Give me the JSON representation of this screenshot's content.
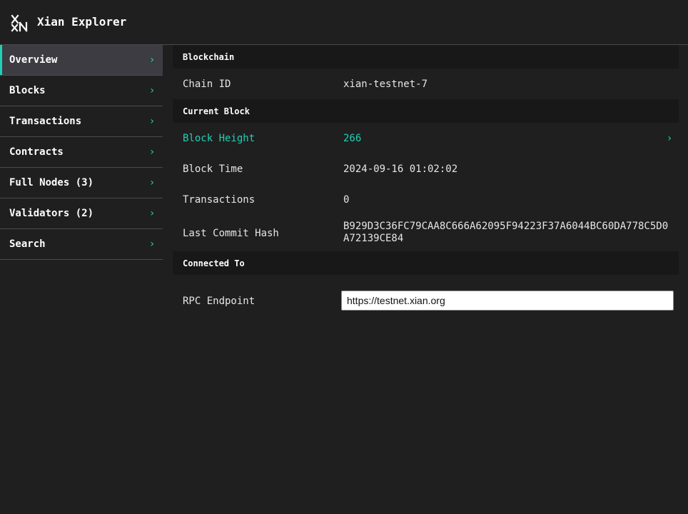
{
  "app": {
    "title": "Xian Explorer",
    "logo_icon": "xian-logo-icon",
    "accent_color": "#1fd1b5"
  },
  "sidebar": {
    "items": [
      {
        "label": "Overview",
        "active": true
      },
      {
        "label": "Blocks"
      },
      {
        "label": "Transactions"
      },
      {
        "label": "Contracts"
      },
      {
        "label": "Full Nodes (3)"
      },
      {
        "label": "Validators (2)"
      },
      {
        "label": "Search"
      }
    ],
    "chevron": "›"
  },
  "main": {
    "blockchain": {
      "heading": "Blockchain",
      "chain_id_label": "Chain ID",
      "chain_id_value": "xian-testnet-7"
    },
    "current_block": {
      "heading": "Current Block",
      "block_height_label": "Block Height",
      "block_height_value": "266",
      "block_time_label": "Block Time",
      "block_time_value": "2024-09-16 01:02:02",
      "transactions_label": "Transactions",
      "transactions_value": "0",
      "last_commit_hash_label": "Last Commit Hash",
      "last_commit_hash_value": "B929D3C36FC79CAA8C666A62095F94223F37A6044BC60DA778C5D0A72139CE84"
    },
    "connected_to": {
      "heading": "Connected To",
      "rpc_label": "RPC Endpoint",
      "rpc_value": "https://testnet.xian.org"
    }
  }
}
